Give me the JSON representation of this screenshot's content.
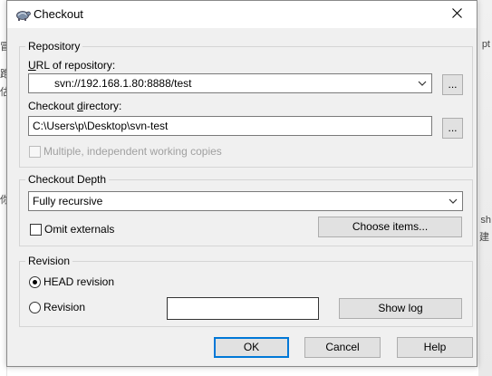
{
  "window": {
    "title": "Checkout"
  },
  "background": {
    "left_glyphs": [
      "冒",
      "跑",
      "估",
      "你"
    ],
    "right_glyphs": [
      "pt",
      "sh",
      "建"
    ]
  },
  "repository": {
    "group_label": "Repository",
    "url_label": "URL of repository:",
    "url_value": "svn://192.168.1.80:8888/test",
    "url_browse": "...",
    "dir_label": "Checkout directory:",
    "dir_value": "C:\\Users\\p\\Desktop\\svn-test",
    "dir_browse": "...",
    "multiple_label": "Multiple, independent working copies"
  },
  "depth": {
    "group_label": "Checkout Depth",
    "selected": "Fully recursive",
    "omit_label": "Omit externals",
    "choose_items": "Choose items..."
  },
  "revision": {
    "group_label": "Revision",
    "head_label": "HEAD revision",
    "revision_label": "Revision",
    "revision_value": "",
    "show_log": "Show log"
  },
  "buttons": {
    "ok": "OK",
    "cancel": "Cancel",
    "help": "Help"
  },
  "icons": {
    "app": "tortoise-icon",
    "close": "close-icon",
    "dropdown": "chevron-down-icon"
  }
}
